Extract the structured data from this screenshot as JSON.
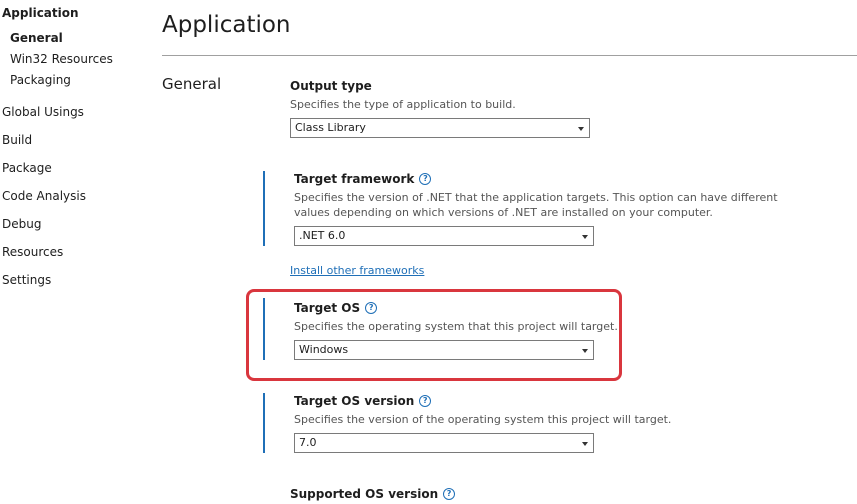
{
  "sidebar": {
    "items": [
      {
        "label": "Application"
      },
      {
        "label": "General"
      },
      {
        "label": "Win32 Resources"
      },
      {
        "label": "Packaging"
      },
      {
        "label": "Global Usings"
      },
      {
        "label": "Build"
      },
      {
        "label": "Package"
      },
      {
        "label": "Code Analysis"
      },
      {
        "label": "Debug"
      },
      {
        "label": "Resources"
      },
      {
        "label": "Settings"
      }
    ]
  },
  "header": {
    "title": "Application",
    "section": "General"
  },
  "settings": {
    "output_type": {
      "title": "Output type",
      "description": "Specifies the type of application to build.",
      "value": "Class Library"
    },
    "target_framework": {
      "title": "Target framework",
      "description": "Specifies the version of .NET that the application targets. This option can have different values depending on which versions of .NET are installed on your computer.",
      "value": ".NET 6.0",
      "link": "Install other frameworks"
    },
    "target_os": {
      "title": "Target OS",
      "description": "Specifies the operating system that this project will target.",
      "value": "Windows"
    },
    "target_os_version": {
      "title": "Target OS version",
      "description": "Specifies the version of the operating system this project will target.",
      "value": "7.0"
    },
    "supported_os_version": {
      "title": "Supported OS version"
    }
  },
  "colors": {
    "accent": "#1f6fb7",
    "highlight": "#d9363e"
  }
}
